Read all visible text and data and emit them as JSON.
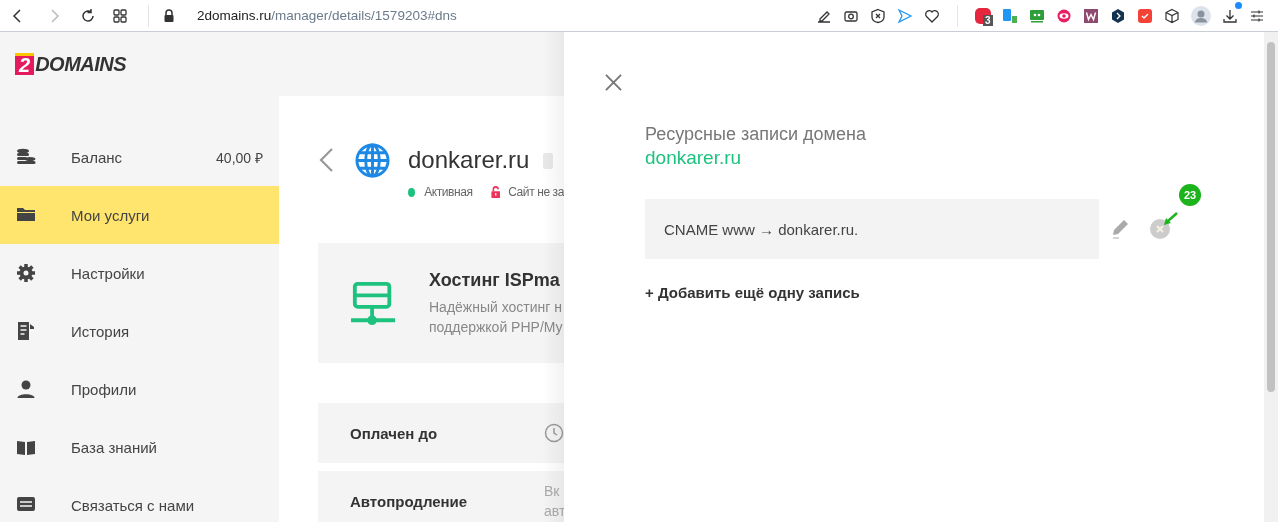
{
  "browser": {
    "url_host": "2domains.ru",
    "url_path": "/manager/details/1579203#dns",
    "adblock_count": "3",
    "download_dot": true
  },
  "sidebar": {
    "logo_digit": "2",
    "logo_text": "DOMAINS",
    "items": [
      {
        "kind": "coins",
        "label": "Баланс",
        "value": "40,00 ₽",
        "selected": false
      },
      {
        "kind": "folder",
        "label": "Мои услуги",
        "selected": true
      },
      {
        "kind": "gear",
        "label": "Настройки",
        "selected": false
      },
      {
        "kind": "history",
        "label": "История",
        "selected": false
      },
      {
        "kind": "person",
        "label": "Профили",
        "selected": false
      },
      {
        "kind": "book",
        "label": "База знаний",
        "selected": false
      },
      {
        "kind": "chat",
        "label": "Связаться с нами",
        "selected": false
      }
    ]
  },
  "service": {
    "domain": "donkarer.ru",
    "status": {
      "label": "Активная",
      "color": "#1ec27f"
    },
    "ssl_status": "Сайт не за",
    "card": {
      "title": "Хостинг ISPma",
      "description_lines": [
        "Надёжный хостинг н",
        "поддержкой PHP/My"
      ]
    },
    "fields": [
      {
        "kind": "date",
        "label": "Оплачен до"
      },
      {
        "kind": "text",
        "label": "Автопродление",
        "value_lines": [
          "Вк",
          "авт"
        ]
      }
    ]
  },
  "drawer": {
    "title": "Ресурсные записи домена",
    "domain": "donkarer.ru",
    "records": [
      {
        "text": "CNAME www → donkarer.ru."
      }
    ],
    "annotation": "23",
    "add_link": "+ Добавить ещё одну запись"
  }
}
